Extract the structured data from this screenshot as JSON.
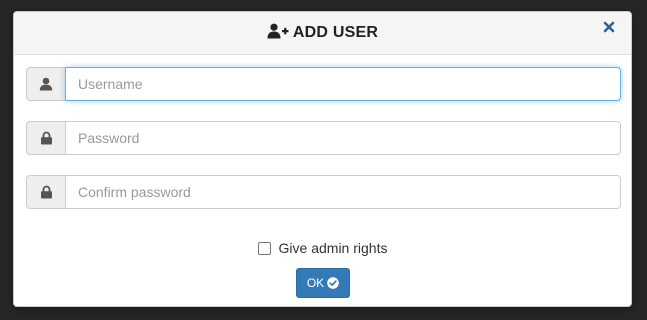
{
  "modal": {
    "title": "ADD USER",
    "title_icon": "user-plus-icon",
    "close_icon": "close-icon"
  },
  "fields": [
    {
      "icon": "user-icon",
      "placeholder": "Username",
      "value": "",
      "focused": true
    },
    {
      "icon": "lock-icon",
      "placeholder": "Password",
      "value": ""
    },
    {
      "icon": "lock-icon",
      "placeholder": "Confirm password",
      "value": ""
    }
  ],
  "admin_checkbox": {
    "label": "Give admin rights",
    "checked": false
  },
  "ok_button": {
    "label": "OK",
    "icon": "check-circle-icon"
  },
  "colors": {
    "primary": "#337ab7",
    "focus_border": "#66afe9",
    "close_icon": "#2a6496"
  }
}
